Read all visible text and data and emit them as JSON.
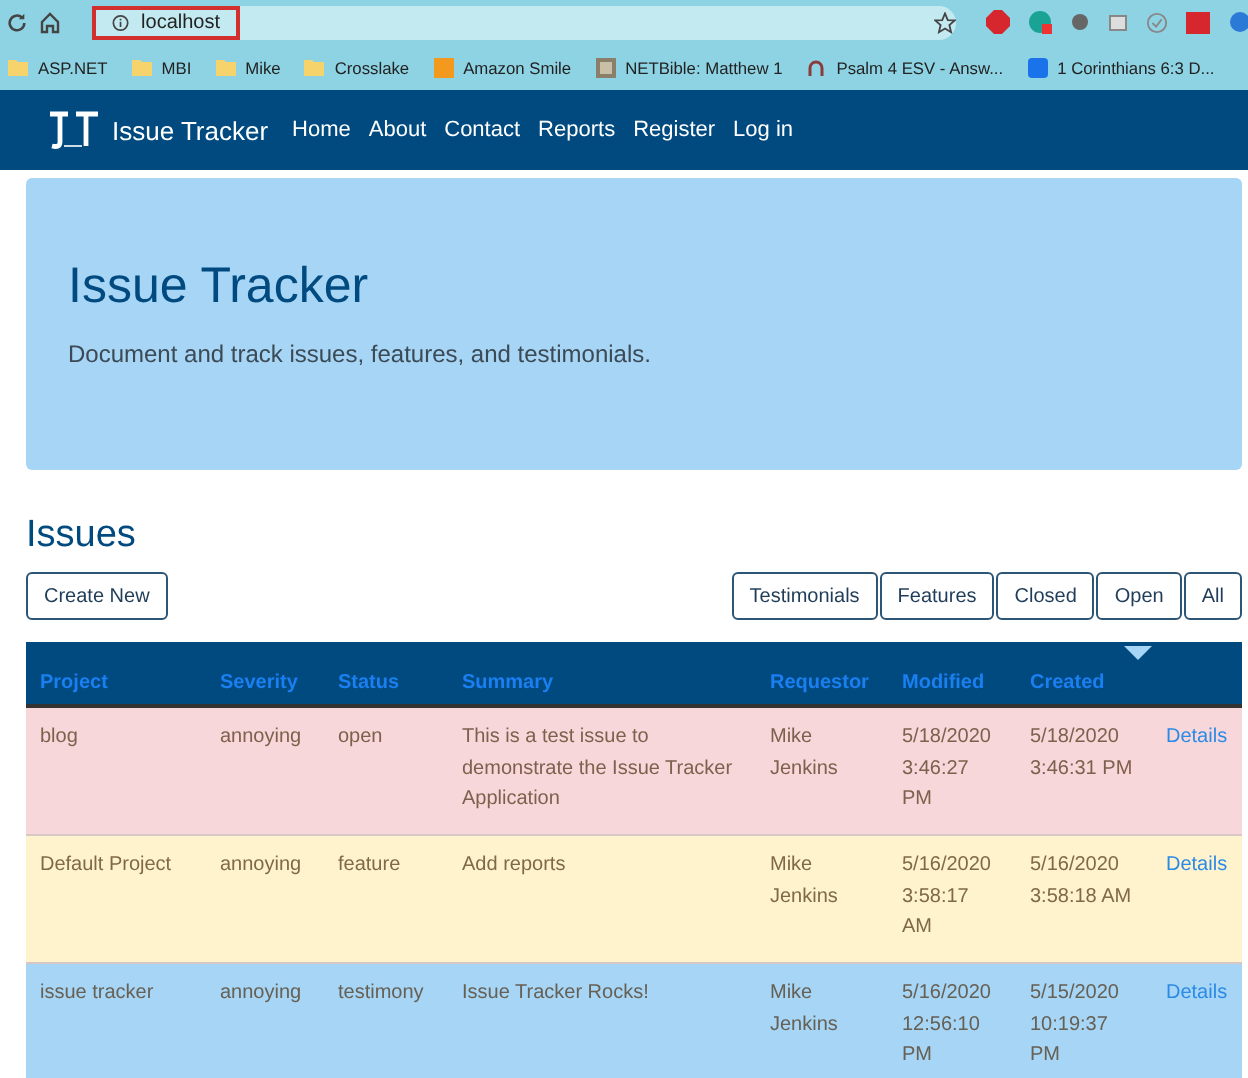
{
  "browser": {
    "address": "localhost",
    "bookmarks": [
      "ASP.NET",
      "MBI",
      "Mike",
      "Crosslake",
      "Amazon Smile",
      "NETBible: Matthew 1",
      "Psalm 4 ESV - Answ...",
      "1 Corinthians 6:3 D..."
    ]
  },
  "navbar": {
    "brand": "Issue Tracker",
    "links": [
      "Home",
      "About",
      "Contact",
      "Reports",
      "Register",
      "Log in"
    ]
  },
  "hero": {
    "title": "Issue Tracker",
    "subtitle": "Document and track issues, features, and testimonials."
  },
  "issues": {
    "heading": "Issues",
    "create_button": "Create New",
    "filters": [
      "Testimonials",
      "Features",
      "Closed",
      "Open",
      "All"
    ],
    "table": {
      "columns": [
        "Project",
        "Severity",
        "Status",
        "Summary",
        "Requestor",
        "Modified",
        "Created"
      ],
      "rows": [
        {
          "color": "#f8d7da",
          "cells": [
            "blog",
            "annoying",
            "open",
            "This is a test issue to demonstrate the Issue Tracker Application",
            "Mike Jenkins",
            "5/18/2020 3:46:27 PM",
            "5/18/2020 3:46:31 PM"
          ],
          "link": "Details"
        },
        {
          "color": "#fff3cd",
          "cells": [
            "Default Project",
            "annoying",
            "feature",
            "Add reports",
            "Mike Jenkins",
            "5/16/2020 3:58:17 AM",
            "5/16/2020 3:58:18 AM"
          ],
          "link": "Details"
        },
        {
          "color": "#a6d5f5",
          "cells": [
            "issue tracker",
            "annoying",
            "testimony",
            "Issue Tracker Rocks!",
            "Mike Jenkins",
            "5/16/2020 12:56:10 PM",
            "5/15/2020 10:19:37 PM"
          ],
          "link": "Details"
        }
      ]
    }
  }
}
